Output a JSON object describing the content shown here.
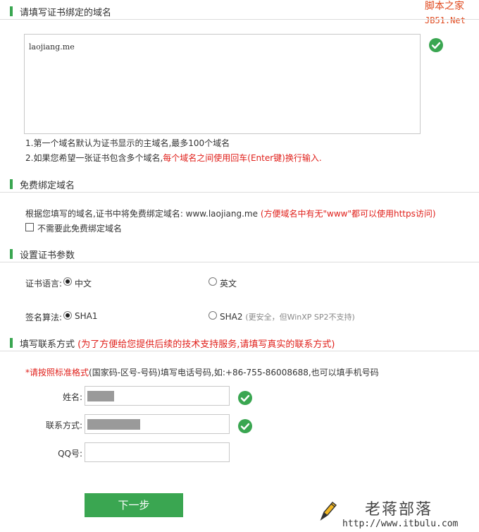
{
  "watermark_top": {
    "line1": "脚本之家",
    "line2": "JB51.Net"
  },
  "section_domain": {
    "title": "请填写证书绑定的域名",
    "textarea_value": "laojiang.me",
    "hint1": "1.第一个域名默认为证书显示的主域名,最多100个域名",
    "hint2_prefix": "2.如果您希望一张证书包含多个域名,",
    "hint2_red": "每个域名之间使用回车(Enter键)换行输入."
  },
  "section_free": {
    "title": "免费绑定域名",
    "text_prefix": "根据您填写的域名,证书中将免费绑定域名: www.laojiang.me",
    "text_red": " (方便域名中有无\"www\"都可以使用https访问)",
    "checkbox_label": "不需要此免费绑定域名"
  },
  "section_params": {
    "title": "设置证书参数",
    "lang_label": "证书语言:",
    "lang_opt1": "中文",
    "lang_opt2": "英文",
    "algo_label": "签名算法:",
    "algo_opt1": "SHA1",
    "algo_opt2": "SHA2",
    "algo_opt2_note": "(更安全，但WinXP SP2不支持)"
  },
  "section_contact": {
    "title": "填写联系方式",
    "title_note": "(为了方便给您提供后续的技术支持服务,请填写真实的联系方式)",
    "hint_red": "*请按照标准格式",
    "hint_rest": "(国家码-区号-号码)填写电话号码,如:+86-755-86008688,也可以填手机号码",
    "name_label": "姓名:",
    "phone_label": "联系方式:",
    "qq_label": "QQ号:"
  },
  "next_button": "下一步",
  "watermark_bottom": {
    "name": "老蒋部落",
    "url": "http://www.itbulu.com"
  },
  "colors": {
    "accent": "#3aa651",
    "warning": "#e0201b"
  }
}
